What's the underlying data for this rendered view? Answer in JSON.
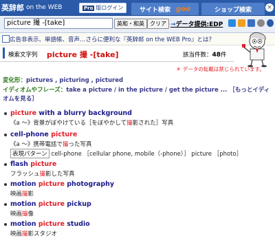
{
  "header": {
    "logo_jp": "英辞郎",
    "logo_en": "on the WEB",
    "pro_tag": "Pro",
    "pro_login": "版ログイン",
    "tab_site_search": "サイト検索",
    "tab_goo": "goo",
    "tab_shop_search": "ショップ検索",
    "close": "×"
  },
  "search": {
    "value": "picture 撮 -[take]",
    "dict_button": "英和・和英",
    "clear_button": "クリア",
    "data_link_arrow": "→",
    "data_link": "データ提供:EDP"
  },
  "promo": {
    "text": "広告非表示、単語帳、音声…さらに便利な『英辞郎 on the WEB Pro』とは？"
  },
  "results": {
    "label": "検索文字列",
    "query": "picture 撮 -[take]",
    "count_label": "該当件数：",
    "count": "48",
    "count_unit": "件"
  },
  "notice": "＊ データの転載は禁じられています。",
  "variants": {
    "label": "変化形：",
    "text": "pictures , picturing , pictured"
  },
  "idioms": {
    "label": "イディオムやフレーズ：",
    "text": "take a picture / in the picture / get the picture ... ［もっとイディオムを見る］"
  },
  "entries": [
    {
      "hl": "picture",
      "rest": " with a blurry background",
      "sub_a": "《a ～》背景がぼやけている［をぼやかして",
      "sub_hl": "撮",
      "sub_b": "影された］写真"
    },
    {
      "pre": "cell-phone ",
      "hl": "picture",
      "rest": "",
      "sub_a": "《a ～》携帯電話で",
      "sub_hl": "撮",
      "sub_b": "った写真",
      "tag": "表現パターン",
      "extra": "cell-phone ［cellular phone, mobile（-phone）］ picture ［photo］"
    },
    {
      "pre": "flash ",
      "hl": "picture",
      "rest": "",
      "sub_a": "フラッシュ",
      "sub_hl": "撮",
      "sub_b": "影した写真"
    },
    {
      "pre": "motion ",
      "hl": "picture",
      "rest": " photography",
      "sub_a": "映画",
      "sub_hl": "撮",
      "sub_b": "影"
    },
    {
      "pre": "motion ",
      "hl": "picture",
      "rest": " pickup",
      "sub_a": "映画",
      "sub_hl": "撮",
      "sub_b": "像"
    },
    {
      "pre": "motion ",
      "hl": "picture",
      "rest": " studio",
      "sub_a": "映画",
      "sub_hl": "撮",
      "sub_b": "影スタジオ"
    }
  ]
}
